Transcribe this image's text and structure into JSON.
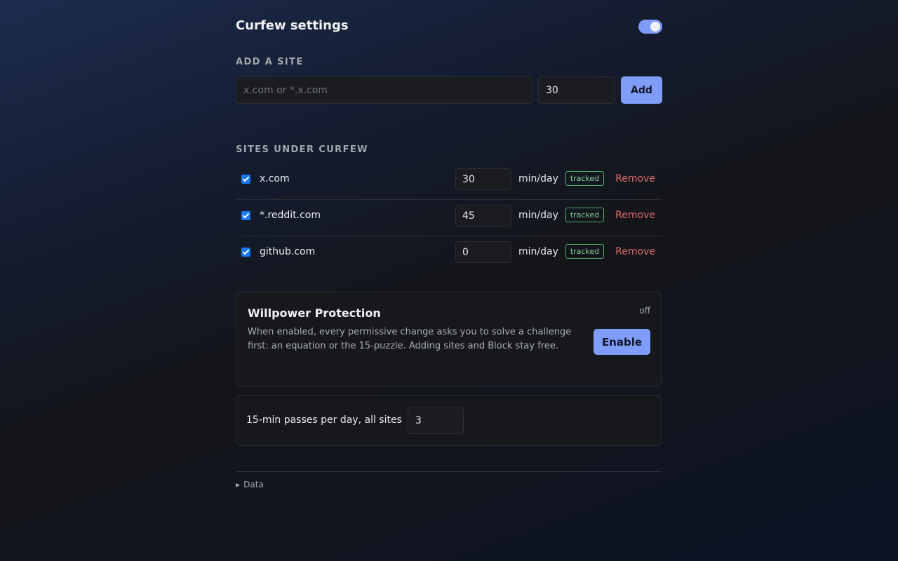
{
  "header": {
    "title": "Curfew settings",
    "enabled": true
  },
  "add_site": {
    "heading": "ADD A SITE",
    "site_placeholder": "x.com or *.x.com",
    "site_value": "",
    "minutes_value": "30",
    "add_label": "Add"
  },
  "sites": {
    "heading": "SITES UNDER CURFEW",
    "items": [
      {
        "checked": true,
        "domain": "x.com",
        "minutes": "30",
        "unit": "min/day",
        "status": "tracked",
        "remove_label": "Remove"
      },
      {
        "checked": true,
        "domain": "*.reddit.com",
        "minutes": "45",
        "unit": "min/day",
        "status": "tracked",
        "remove_label": "Remove"
      },
      {
        "checked": true,
        "domain": "github.com",
        "minutes": "0",
        "unit": "min/day",
        "status": "tracked",
        "remove_label": "Remove"
      }
    ]
  },
  "willpower": {
    "title": "Willpower Protection",
    "status": "off",
    "description": "When enabled, every permissive change asks you to solve a challenge first: an equation or the 15-puzzle. Adding sites and Block stay free.",
    "enable_label": "Enable"
  },
  "passes": {
    "label": "15-min passes per day, all sites",
    "value": "3"
  },
  "data_section": {
    "label": "Data",
    "expanded": false
  },
  "colors": {
    "accent": "#7f9cf8",
    "danger": "#e06b6b",
    "tracked": "#7fd19a",
    "checkbox": "#1677f0"
  }
}
